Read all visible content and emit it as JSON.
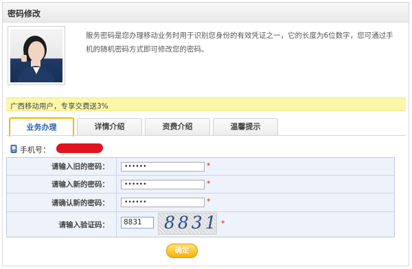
{
  "header": {
    "title": "密码修改"
  },
  "intro": {
    "text": "服务密码是您办理移动业务时用于识别您身份的有效凭证之一，它的长度为6位数字，您可通过手机的随机密码方式即可修改您的密码。"
  },
  "promo": {
    "text": "广西移动用户，专享交费送3%"
  },
  "tabs": [
    {
      "label": "业务办理",
      "active": true
    },
    {
      "label": "详情介绍",
      "active": false
    },
    {
      "label": "资费介绍",
      "active": false
    },
    {
      "label": "温馨提示",
      "active": false
    }
  ],
  "phone": {
    "label": "手机号："
  },
  "form": {
    "rows": [
      {
        "label": "请输入旧的密码：",
        "value": "••••••",
        "required_mark": "*"
      },
      {
        "label": "请输入新的密码：",
        "value": "••••••",
        "required_mark": "*"
      },
      {
        "label": "请确认新的密码：",
        "value": "••••••",
        "required_mark": "*"
      }
    ],
    "captcha": {
      "label": "请输入验证码：",
      "value": "8831",
      "image_text": "8831",
      "required_mark": "*"
    }
  },
  "confirm_label": "确定",
  "colors": {
    "accent": "#f0b400",
    "tab_active_text": "#2e63a8",
    "promo_bg": "#fcf7a8",
    "required": "#e01a1a",
    "redaction": "#e1131f"
  }
}
